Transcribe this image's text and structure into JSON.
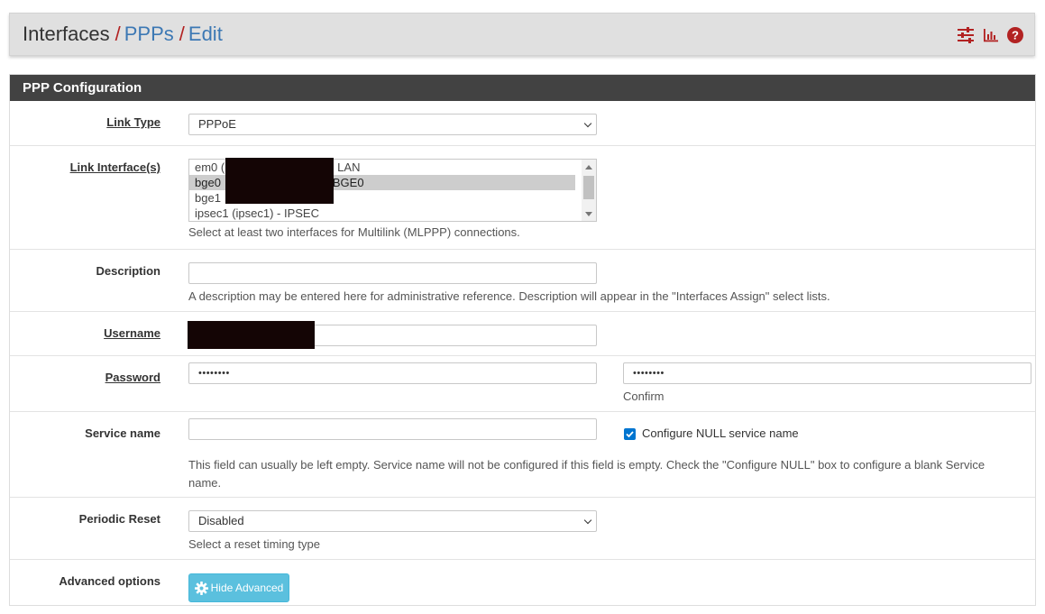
{
  "breadcrumb": {
    "first": "Interfaces",
    "second": "PPPs",
    "third": "Edit",
    "separator": "/"
  },
  "header_icons": [
    "sliders-icon",
    "bar-chart-icon",
    "help-icon"
  ],
  "panel": {
    "title": "PPP Configuration"
  },
  "fields": {
    "link_type": {
      "label": "Link Type",
      "value": "PPPoE"
    },
    "link_interfaces": {
      "label": "Link Interface(s)",
      "options": [
        {
          "text_left": "em0 (",
          "text_right": "- LAN",
          "selected": false
        },
        {
          "text_left": "bge0",
          "text_right": "- BGE0",
          "selected": true
        },
        {
          "text_left": "bge1",
          "text_right": "",
          "selected": false
        },
        {
          "text_left": "ipsec1 (ipsec1) - IPSEC",
          "text_right": "",
          "selected": false
        }
      ],
      "help": "Select at least two interfaces for Multilink (MLPPP) connections."
    },
    "description": {
      "label": "Description",
      "value": "",
      "help": "A description may be entered here for administrative reference. Description will appear in the \"Interfaces Assign\" select lists."
    },
    "username": {
      "label": "Username",
      "value": ""
    },
    "password": {
      "label": "Password",
      "value": "••••••••",
      "confirm_value": "••••••••",
      "confirm_label": "Confirm"
    },
    "service_name": {
      "label": "Service name",
      "value": "",
      "null_checkbox_label": "Configure NULL service name",
      "null_checked": true,
      "help": "This field can usually be left empty. Service name will not be configured if this field is empty. Check the \"Configure NULL\" box to configure a blank Service name."
    },
    "periodic_reset": {
      "label": "Periodic Reset",
      "value": "Disabled",
      "help": "Select a reset timing type"
    },
    "advanced": {
      "label": "Advanced options",
      "button_label": "Hide Advanced"
    }
  },
  "colors": {
    "accent_red": "#b22222",
    "link_blue": "#3c78b4",
    "panel_heading": "#424242",
    "info_button": "#5bc0de",
    "checkbox": "#0075d0"
  }
}
